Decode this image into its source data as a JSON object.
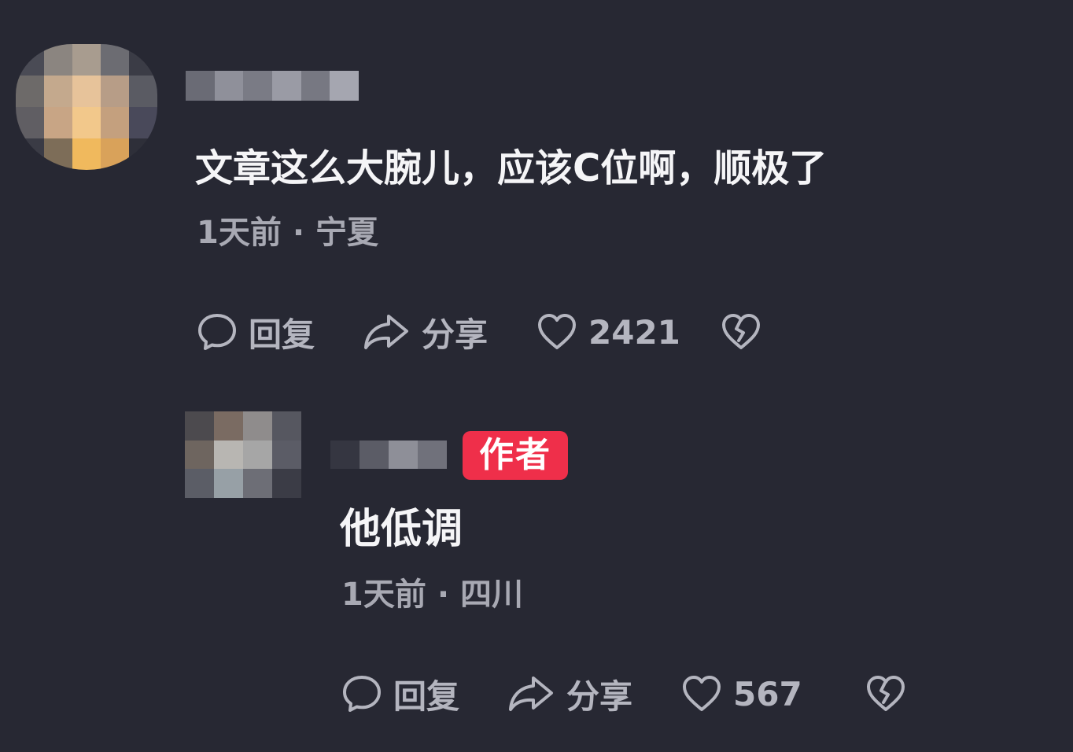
{
  "colors": {
    "background": "#272833",
    "primary_text": "#f5f5f7",
    "secondary_text": "#a8a9b3",
    "author_badge": "#ef2f4a"
  },
  "comments": [
    {
      "text": "文章这么大腕儿，应该C位啊，顺极了",
      "time": "1天前",
      "separator": "·",
      "location": "宁夏",
      "reply_label": "回复",
      "share_label": "分享",
      "like_count": "2421",
      "avatar_pixels": [
        "#4a4b55",
        "#8b8580",
        "#a89c8f",
        "#6c6c72",
        "#3b3c46",
        "#6d6a69",
        "#c4a98d",
        "#e7c39a",
        "#b79d87",
        "#5a5b63",
        "#605e63",
        "#c8a585",
        "#f2c88b",
        "#c4a07e",
        "#49495a",
        "#3a3b45",
        "#7d6d58",
        "#f0b95d",
        "#d9a25a",
        "#2e2f39"
      ],
      "name_pixels": [
        "#6a6b75",
        "#8f909a",
        "#7a7b85",
        "#9a9ba5",
        "#777882",
        "#a5a6b0"
      ]
    },
    {
      "text": "他低调",
      "author_badge": "作者",
      "time": "1天前",
      "separator": "·",
      "location": "四川",
      "reply_label": "回复",
      "share_label": "分享",
      "like_count": "567",
      "avatar_pixels": [
        "#4c4a4e",
        "#7a6b62",
        "#8f8c8c",
        "#565760",
        "#6e655f",
        "#b8b6b2",
        "#a6a6a6",
        "#5b5c66",
        "#5b5d66",
        "#97a0a6",
        "#6d6e76",
        "#3b3c46"
      ],
      "name_pixels": [
        "#353641",
        "#5b5c66",
        "#8e8f98",
        "#70717b"
      ]
    }
  ],
  "icons": {
    "reply": "comment-bubble-icon",
    "share": "share-arrow-icon",
    "like": "heart-icon",
    "dislike": "broken-heart-icon"
  }
}
